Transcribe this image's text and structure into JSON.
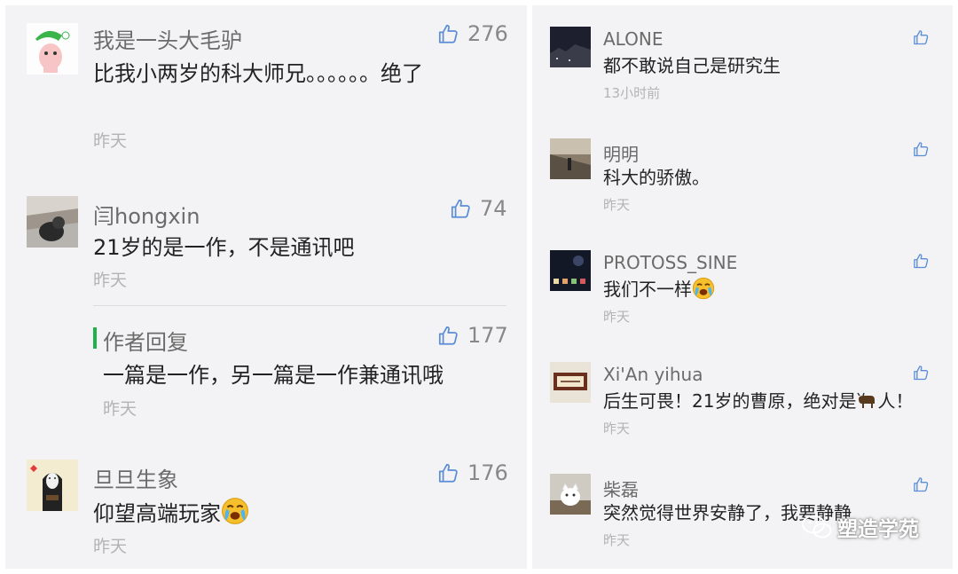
{
  "left_comments": [
    {
      "name": "我是一头大毛驴",
      "likes": "276",
      "text": "比我小两岁的科大师兄。。。。。。绝了",
      "time": "昨天"
    },
    {
      "name": "闫hongxin",
      "likes": "74",
      "text": "21岁的是一作，不是通讯吧",
      "time": "昨天"
    },
    {
      "name": "旦旦生象",
      "likes": "176",
      "text": "仰望高端玩家",
      "time": "昨天"
    }
  ],
  "author_reply": {
    "label": "作者回复",
    "likes": "177",
    "text": "一篇是一作，另一篇是一作兼通讯哦",
    "time": "昨天"
  },
  "right_comments": [
    {
      "name": "ALONE",
      "text": "都不敢说自己是研究生",
      "time": "13小时前"
    },
    {
      "name": "明明",
      "text": "科大的骄傲。",
      "time": "昨天"
    },
    {
      "name": "PROTOSS_SINE",
      "text": "我们不一样",
      "time": "昨天"
    },
    {
      "name": "Xi'An yihua",
      "text": "后生可畏！21岁的曹原，绝对是",
      "text_end": "人！",
      "time": "昨天"
    },
    {
      "name": "柴磊",
      "text": "突然觉得世界安静了，我要静静",
      "time": "昨天"
    }
  ],
  "watermark": "塑造学苑",
  "colors": {
    "panel_bg": "#f3f3f5",
    "name": "#6b6b6b",
    "time": "#b3b3b3",
    "thumb": "#5b8dd6",
    "reply_bar": "#21b04a"
  }
}
